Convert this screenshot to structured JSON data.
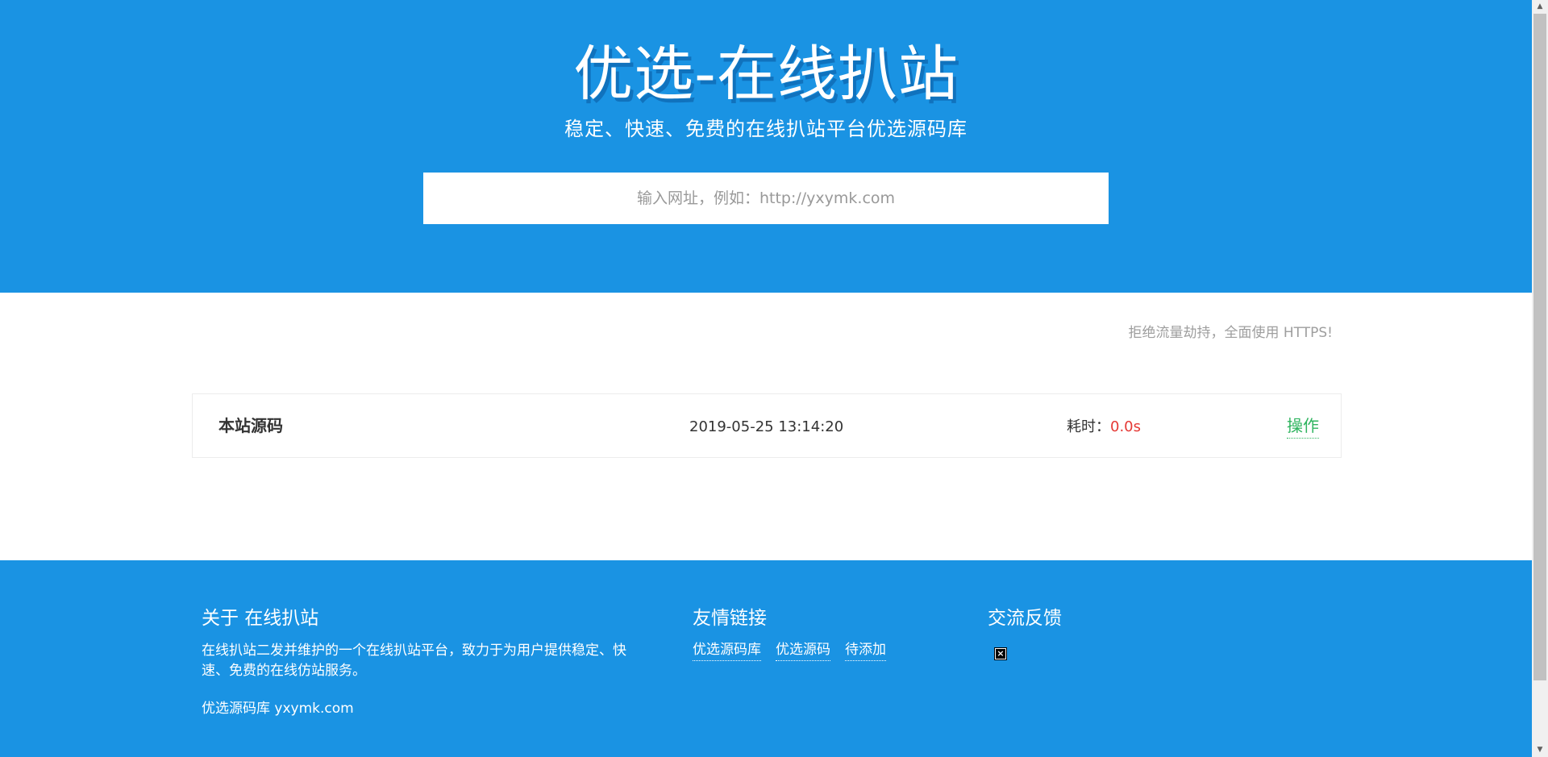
{
  "hero": {
    "title": "优选-在线扒站",
    "subtitle": "稳定、快速、免费的在线扒站平台优选源码库",
    "search_placeholder": "输入网址，例如：http://yxymk.com"
  },
  "notice": "拒绝流量劫持，全面使用 HTTPS!",
  "result_row": {
    "name": "本站源码",
    "date": "2019-05-25 13:14:20",
    "time_label": "耗时：",
    "time_value": "0.0s",
    "action_label": "操作"
  },
  "footer": {
    "about_title": "关于 在线扒站",
    "about_text": "在线扒站二发并维护的一个在线扒站平台，致力于为用户提供稳定、快速、免费的在线仿站服务。",
    "about_site": "优选源码库 yxymk.com",
    "links_title": "友情链接",
    "links": [
      "优选源码库",
      "优选源码",
      "待添加"
    ],
    "feedback_title": "交流反馈",
    "feedback_icon": "broken-image-icon"
  },
  "colors": {
    "brand_blue": "#1a93e3",
    "action_green": "#2fb45f",
    "time_red": "#e53935",
    "notice_gray": "#9e9e9e"
  }
}
